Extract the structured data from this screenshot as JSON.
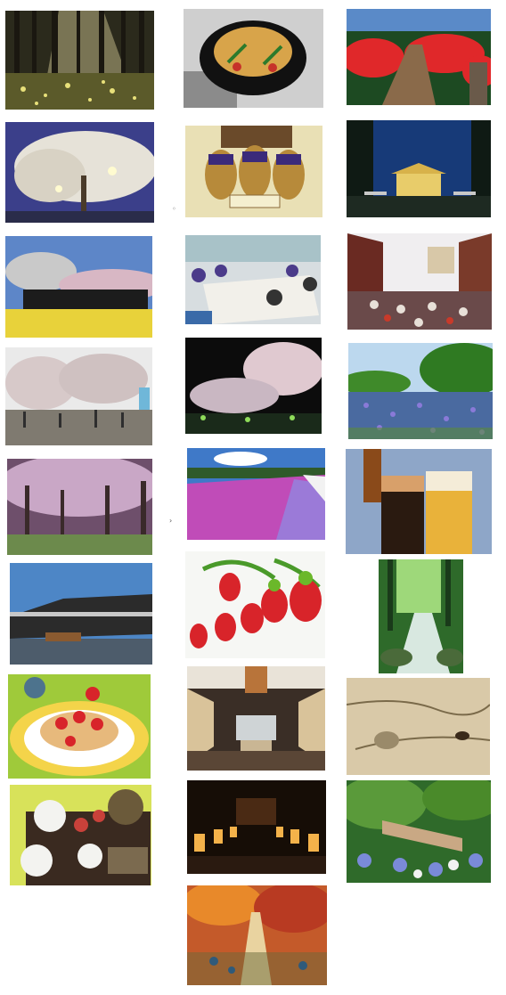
{
  "gallery": {
    "markers": {
      "mid_small": "◦",
      "mid_arrow": "›"
    },
    "tiles": [
      {
        "name": "forest-sunrays-photo",
        "icon": "forest-photo"
      },
      {
        "name": "noodle-bowl-photo",
        "icon": "food-photo"
      },
      {
        "name": "azalea-stairs-photo",
        "icon": "flower-photo"
      },
      {
        "name": "lit-cherry-tree-photo",
        "icon": "night-photo"
      },
      {
        "name": "sake-jars-photo",
        "icon": "product-photo"
      },
      {
        "name": "shrine-night-photo",
        "icon": "temple-photo"
      },
      {
        "name": "steam-train-photo",
        "icon": "train-photo"
      },
      {
        "name": "festival-crowd-photo",
        "icon": "event-photo"
      },
      {
        "name": "street-festival-photo",
        "icon": "event-photo"
      },
      {
        "name": "blossom-park-photo",
        "icon": "park-photo"
      },
      {
        "name": "night-blossom-photo",
        "icon": "night-photo"
      },
      {
        "name": "blue-flower-field-photo",
        "icon": "flower-photo"
      },
      {
        "name": "cherry-avenue-photo",
        "icon": "park-photo"
      },
      {
        "name": "moss-phlox-field-photo",
        "icon": "flower-photo"
      },
      {
        "name": "beer-glasses-photo",
        "icon": "drink-photo"
      },
      {
        "name": "riverside-building-photo",
        "icon": "building-photo"
      },
      {
        "name": "strawberries-photo",
        "icon": "food-photo"
      },
      {
        "name": "forest-stream-photo",
        "icon": "nature-photo"
      },
      {
        "name": "pancakes-photo",
        "icon": "food-photo"
      },
      {
        "name": "museum-hall-photo",
        "icon": "interior-photo"
      },
      {
        "name": "scroll-painting-photo",
        "icon": "art-photo"
      },
      {
        "name": "set-meal-photo",
        "icon": "food-photo"
      },
      {
        "name": "lantern-path-photo",
        "icon": "night-photo"
      },
      {
        "name": "hydrangea-bridge-photo",
        "icon": "flower-photo"
      },
      {
        "name": "autumn-leaves-photo",
        "icon": "nature-photo"
      }
    ]
  }
}
